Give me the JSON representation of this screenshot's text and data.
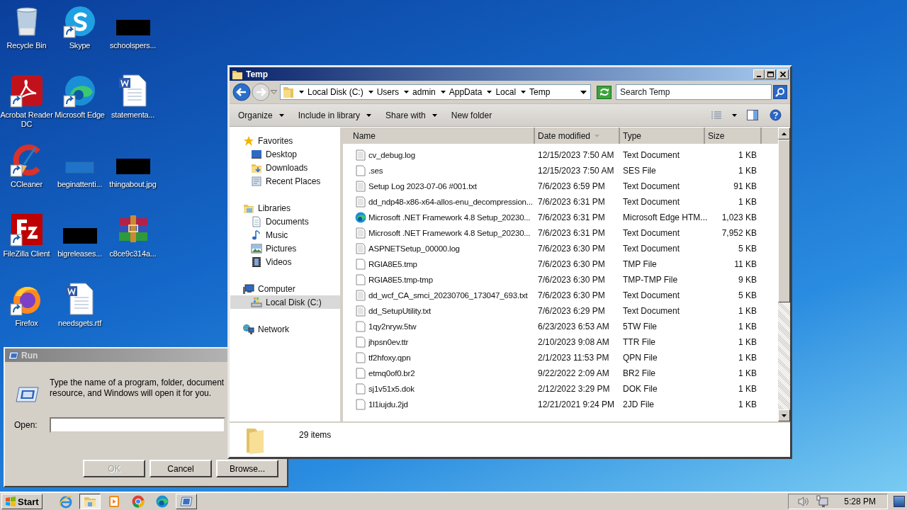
{
  "desktop": {
    "icons": [
      {
        "label": "Recycle Bin",
        "kind": "bin",
        "shortcut": false
      },
      {
        "label": "Acrobat Reader DC",
        "kind": "acrobat",
        "shortcut": true
      },
      {
        "label": "CCleaner",
        "kind": "ccleaner",
        "shortcut": true
      },
      {
        "label": "FileZilla Client",
        "kind": "filezilla",
        "shortcut": true
      },
      {
        "label": "Firefox",
        "kind": "firefox",
        "shortcut": true
      },
      {
        "label": "Skype",
        "kind": "skype",
        "shortcut": true
      },
      {
        "label": "Microsoft Edge",
        "kind": "edge",
        "shortcut": true
      },
      {
        "label": "beginattenti...",
        "kind": "blank",
        "shortcut": false
      },
      {
        "label": "bigreleases...",
        "kind": "redacted",
        "shortcut": false
      },
      {
        "label": "needsgets.rtf",
        "kind": "word",
        "shortcut": false
      },
      {
        "label": "schoolspers...",
        "kind": "redacted",
        "shortcut": false
      },
      {
        "label": "statementa...",
        "kind": "word",
        "shortcut": false
      },
      {
        "label": "thingabout.jpg",
        "kind": "redacted",
        "shortcut": false
      },
      {
        "label": "c8ce9c314a...",
        "kind": "archive",
        "shortcut": false
      }
    ]
  },
  "run_dialog": {
    "title": "Run",
    "lines": [
      "Type the name of a program, folder, document",
      "resource, and Windows will open it for you."
    ],
    "open_label": "Open:",
    "buttons": [
      {
        "label": "OK",
        "disabled": true
      },
      {
        "label": "Cancel",
        "disabled": false
      },
      {
        "label": "Browse...",
        "disabled": false
      }
    ]
  },
  "explorer": {
    "title": "Temp",
    "breadcrumb": [
      "Local Disk (C:)",
      "Users",
      "admin",
      "AppData",
      "Local",
      "Temp"
    ],
    "search": {
      "placeholder": "Search Temp"
    },
    "toolbar": [
      {
        "label": "Organize",
        "menu": true
      },
      {
        "label": "Include in library",
        "menu": true
      },
      {
        "label": "Share with",
        "menu": true
      },
      {
        "label": "New folder",
        "menu": false
      }
    ],
    "nav": [
      {
        "label": "Favorites",
        "kind": "star",
        "selected": false,
        "children": [
          {
            "label": "Desktop",
            "kind": "desktop",
            "selected": false
          },
          {
            "label": "Downloads",
            "kind": "downloads",
            "selected": false
          },
          {
            "label": "Recent Places",
            "kind": "recent",
            "selected": false
          }
        ]
      },
      {
        "label": "Libraries",
        "kind": "library",
        "selected": false,
        "children": [
          {
            "label": "Documents",
            "kind": "documents",
            "selected": false
          },
          {
            "label": "Music",
            "kind": "music",
            "selected": false
          },
          {
            "label": "Pictures",
            "kind": "pictures",
            "selected": false
          },
          {
            "label": "Videos",
            "kind": "videos",
            "selected": false
          }
        ]
      },
      {
        "label": "Computer",
        "kind": "computer",
        "selected": false,
        "children": [
          {
            "label": "Local Disk (C:)",
            "kind": "disk",
            "selected": true
          }
        ]
      },
      {
        "label": "Network",
        "kind": "network",
        "selected": false
      }
    ],
    "columns": [
      {
        "label": "Name",
        "sorted": false
      },
      {
        "label": "Date modified",
        "sorted": true
      },
      {
        "label": "Type",
        "sorted": false
      },
      {
        "label": "Size",
        "sorted": false
      }
    ],
    "rows": [
      {
        "name": "cv_debug.log",
        "date": "12/15/2023 7:50 AM",
        "type": "Text Document",
        "size": "1 KB",
        "kind": "text"
      },
      {
        "name": ".ses",
        "date": "12/15/2023 7:50 AM",
        "type": "SES File",
        "size": "1 KB",
        "kind": "file"
      },
      {
        "name": "Setup Log 2023-07-06 #001.txt",
        "date": "7/6/2023 6:59 PM",
        "type": "Text Document",
        "size": "91 KB",
        "kind": "text"
      },
      {
        "name": "dd_ndp48-x86-x64-allos-enu_decompression...",
        "date": "7/6/2023 6:31 PM",
        "type": "Text Document",
        "size": "1 KB",
        "kind": "text"
      },
      {
        "name": "Microsoft .NET Framework 4.8 Setup_20230...",
        "date": "7/6/2023 6:31 PM",
        "type": "Microsoft Edge HTM...",
        "size": "1,023 KB",
        "kind": "edge"
      },
      {
        "name": "Microsoft .NET Framework 4.8 Setup_20230...",
        "date": "7/6/2023 6:31 PM",
        "type": "Text Document",
        "size": "7,952 KB",
        "kind": "text"
      },
      {
        "name": "ASPNETSetup_00000.log",
        "date": "7/6/2023 6:30 PM",
        "type": "Text Document",
        "size": "5 KB",
        "kind": "text"
      },
      {
        "name": "RGIA8E5.tmp",
        "date": "7/6/2023 6:30 PM",
        "type": "TMP File",
        "size": "11 KB",
        "kind": "file"
      },
      {
        "name": "RGIA8E5.tmp-tmp",
        "date": "7/6/2023 6:30 PM",
        "type": "TMP-TMP File",
        "size": "9 KB",
        "kind": "file"
      },
      {
        "name": "dd_wcf_CA_smci_20230706_173047_693.txt",
        "date": "7/6/2023 6:30 PM",
        "type": "Text Document",
        "size": "5 KB",
        "kind": "text"
      },
      {
        "name": "dd_SetupUtility.txt",
        "date": "7/6/2023 6:29 PM",
        "type": "Text Document",
        "size": "1 KB",
        "kind": "text"
      },
      {
        "name": "1qy2nryw.5tw",
        "date": "6/23/2023 6:53 AM",
        "type": "5TW File",
        "size": "1 KB",
        "kind": "file"
      },
      {
        "name": "jhpsn0ev.ttr",
        "date": "2/10/2023 9:08 AM",
        "type": "TTR File",
        "size": "1 KB",
        "kind": "file"
      },
      {
        "name": "tf2hfoxy.qpn",
        "date": "2/1/2023 11:53 PM",
        "type": "QPN File",
        "size": "1 KB",
        "kind": "file"
      },
      {
        "name": "etmq0of0.br2",
        "date": "9/22/2022 2:09 AM",
        "type": "BR2 File",
        "size": "1 KB",
        "kind": "file"
      },
      {
        "name": "sj1v51x5.dok",
        "date": "2/12/2022 3:29 PM",
        "type": "DOK File",
        "size": "1 KB",
        "kind": "file"
      },
      {
        "name": "1l1iujdu.2jd",
        "date": "12/21/2021 9:24 PM",
        "type": "2JD File",
        "size": "1 KB",
        "kind": "file"
      }
    ],
    "status": "29 items"
  },
  "taskbar": {
    "start": "Start",
    "apps": [
      {
        "kind": "ie",
        "active": false,
        "running": false
      },
      {
        "kind": "explorer",
        "active": true,
        "running": true
      },
      {
        "kind": "media",
        "active": false,
        "running": false
      },
      {
        "kind": "chrome",
        "active": false,
        "running": false
      },
      {
        "kind": "edge",
        "active": false,
        "running": false
      },
      {
        "kind": "run",
        "active": false,
        "running": true
      }
    ],
    "clock": "5:28 PM"
  }
}
